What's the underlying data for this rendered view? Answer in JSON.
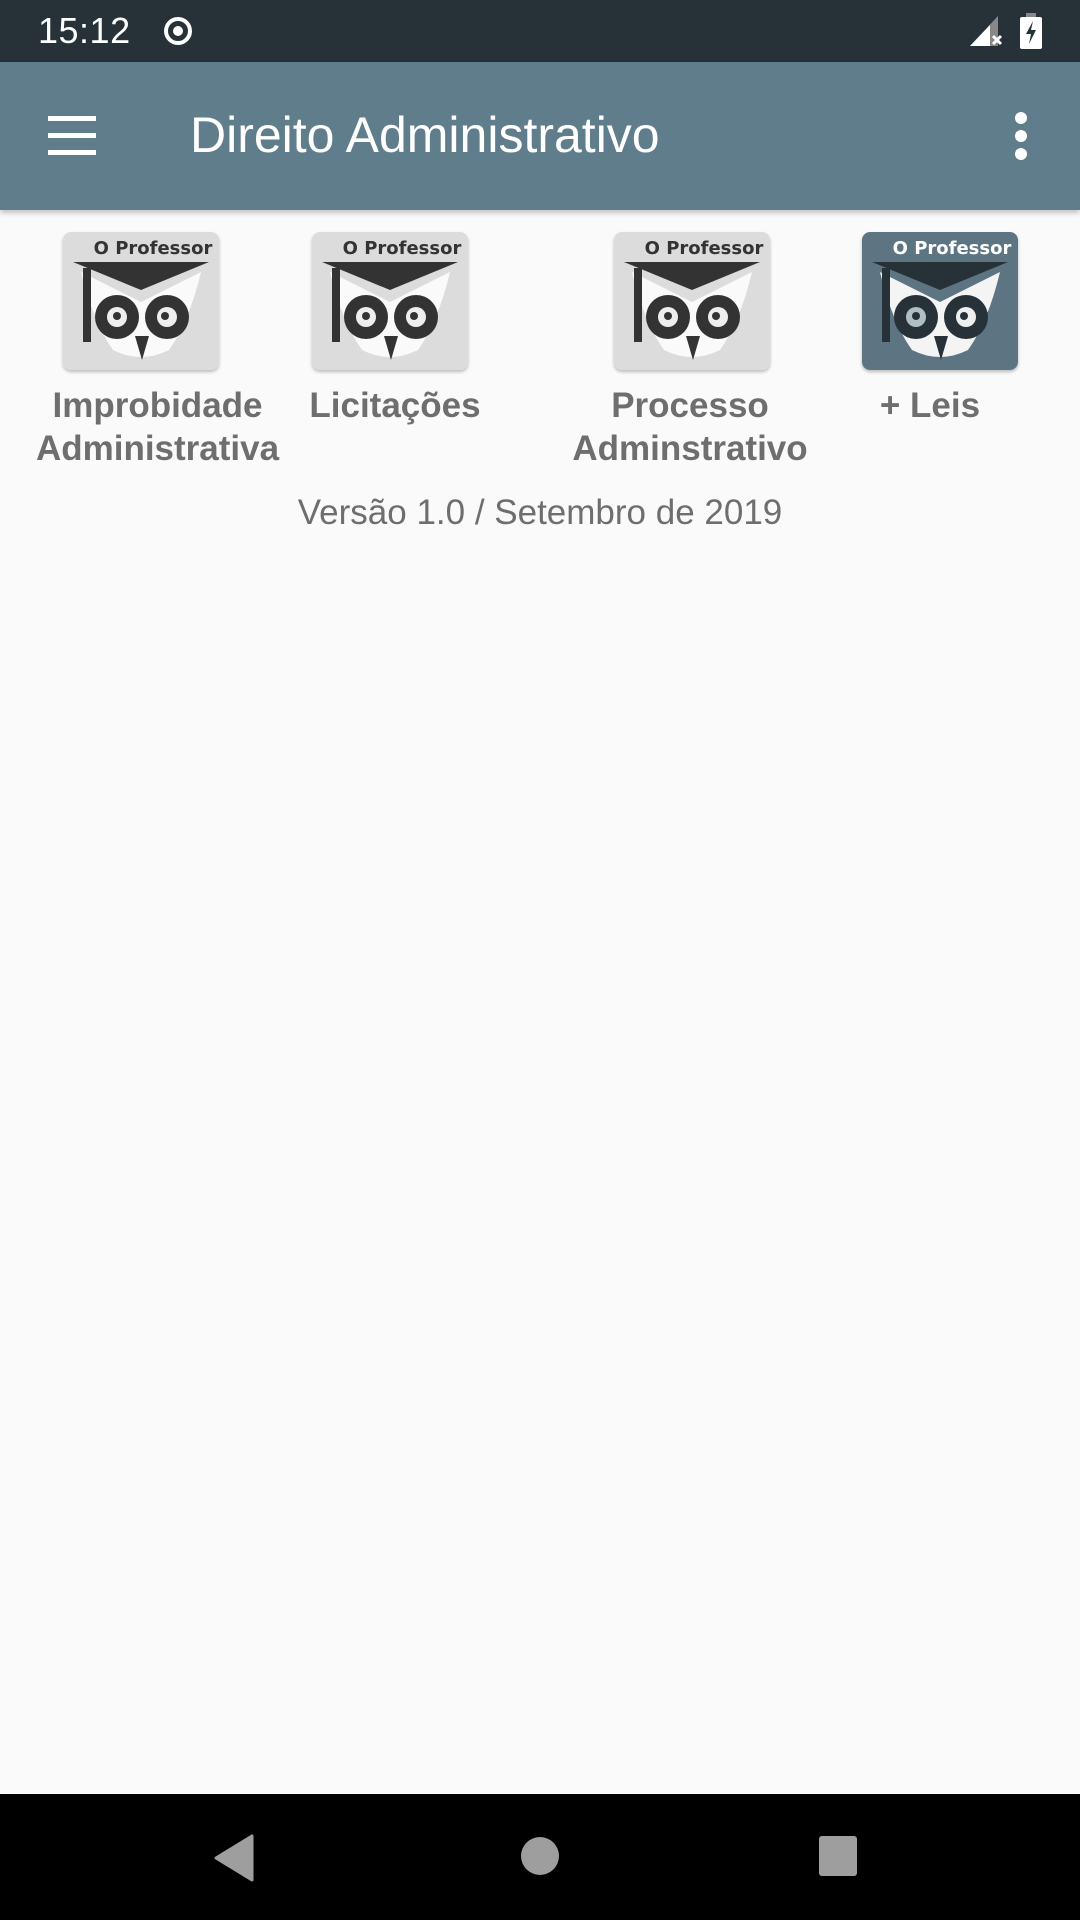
{
  "status_bar": {
    "time": "15:12",
    "icons": [
      "record-icon",
      "signal-no-sim-icon",
      "battery-charging-icon"
    ]
  },
  "app_bar": {
    "title": "Direito Administrativo",
    "menu_icon": "hamburger-menu-icon",
    "overflow_icon": "more-vertical-icon"
  },
  "tiles": [
    {
      "icon_text": "O Professor",
      "label_line1": "Improbidade",
      "label_line2": "Administrativa",
      "theme": "light"
    },
    {
      "icon_text": "O Professor",
      "label_line1": "Licitações",
      "label_line2": "",
      "theme": "light"
    },
    {
      "icon_text": "O Professor",
      "label_line1": "Processo",
      "label_line2": "Adminstrativo",
      "theme": "light"
    },
    {
      "icon_text": "O Professor",
      "label_line1": "+ Leis",
      "label_line2": "",
      "theme": "dark"
    }
  ],
  "version_text": "Versão 1.0 / Setembro de 2019",
  "nav_bar": {
    "buttons": [
      "back",
      "home",
      "recents"
    ]
  },
  "colors": {
    "status_bar": "#263238",
    "app_bar": "#607d8b",
    "background": "#fafafa",
    "label_text": "#6e6e6e",
    "tile_light": "#dcdcdc",
    "tile_dark": "#5d7582"
  }
}
